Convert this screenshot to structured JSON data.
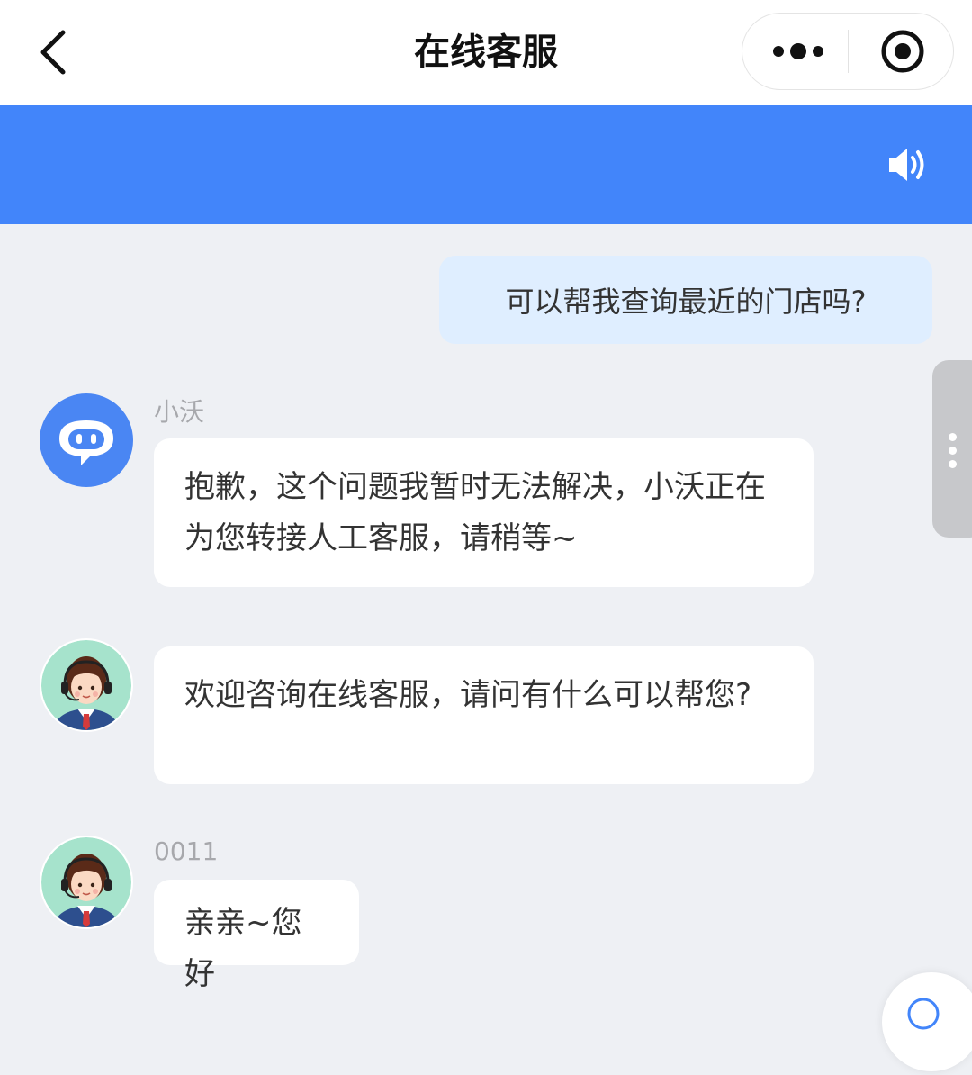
{
  "header": {
    "title": "在线客服",
    "back_icon": "chevron-left-icon",
    "more_icon": "more-dots-icon",
    "close_icon": "target-circle-icon"
  },
  "banner": {
    "color": "#4285fa",
    "speaker_icon": "speaker-icon"
  },
  "messages": [
    {
      "role": "user",
      "text": "可以帮我查询最近的门店吗?"
    },
    {
      "role": "bot",
      "name": "小沃",
      "avatar": "robot-avatar-icon",
      "text": "抱歉，这个问题我暂时无法解决，小沃正在为您转接人工客服，请稍等~"
    },
    {
      "role": "agent",
      "name": "",
      "avatar": "agent-avatar-icon",
      "text": "欢迎咨询在线客服，请问有什么可以帮您?"
    },
    {
      "role": "agent",
      "name": "0011",
      "avatar": "agent-avatar-icon",
      "text": "亲亲~您好"
    }
  ],
  "colors": {
    "accent": "#4285fa",
    "user_bubble": "#dfeeff",
    "background": "#eef0f4"
  }
}
